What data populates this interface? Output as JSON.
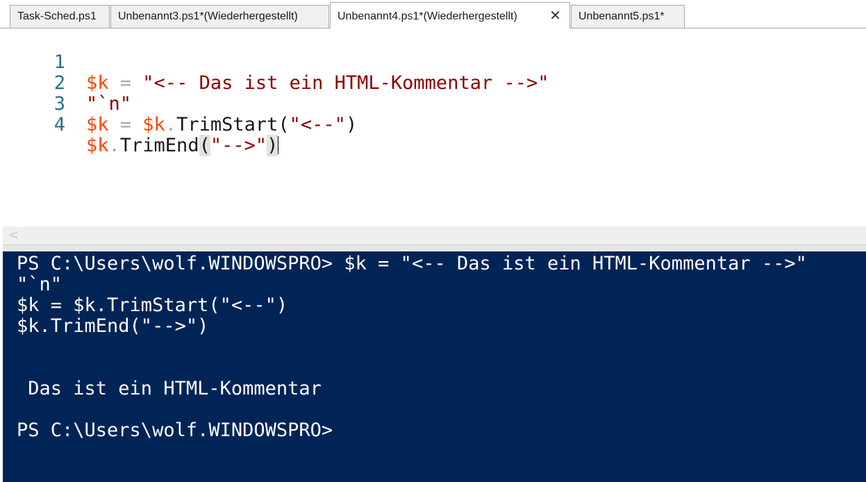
{
  "tabs": [
    {
      "label": "Task-Sched.ps1"
    },
    {
      "label": "Unbenannt3.ps1*(Wiederhergestellt)"
    },
    {
      "label": "Unbenannt4.ps1*(Wiederhergestellt)",
      "active": true,
      "close_icon": "✕"
    },
    {
      "label": "Unbenannt5.ps1*"
    }
  ],
  "editor": {
    "lines": [
      {
        "num": "1",
        "tokens": [
          "$k",
          " = ",
          "\"<-- Das ist ein HTML-Kommentar -->\""
        ]
      },
      {
        "num": "2",
        "tokens": [
          "\"`n\""
        ]
      },
      {
        "num": "3",
        "tokens": [
          "$k",
          " = ",
          "$k",
          ".",
          "TrimStart",
          "(",
          "\"<--\"",
          ")"
        ]
      },
      {
        "num": "4",
        "tokens": [
          "$k",
          ".",
          "TrimEnd",
          "(",
          "\"-->\"",
          ")"
        ]
      }
    ]
  },
  "scrollbar": {
    "left_arrow": "<"
  },
  "console": {
    "lines": [
      "PS C:\\Users\\wolf.WINDOWSPRO> $k = \"<-- Das ist ein HTML-Kommentar -->\"",
      "\"`n\"",
      "$k = $k.TrimStart(\"<--\")",
      "$k.TrimEnd(\"-->\")",
      "",
      "",
      " Das ist ein HTML-Kommentar",
      "",
      "PS C:\\Users\\wolf.WINDOWSPRO>"
    ]
  },
  "colors": {
    "console_background": "#012456",
    "variable": "#ff4500",
    "string": "#8b0000",
    "line_number": "#2b6f8a"
  }
}
